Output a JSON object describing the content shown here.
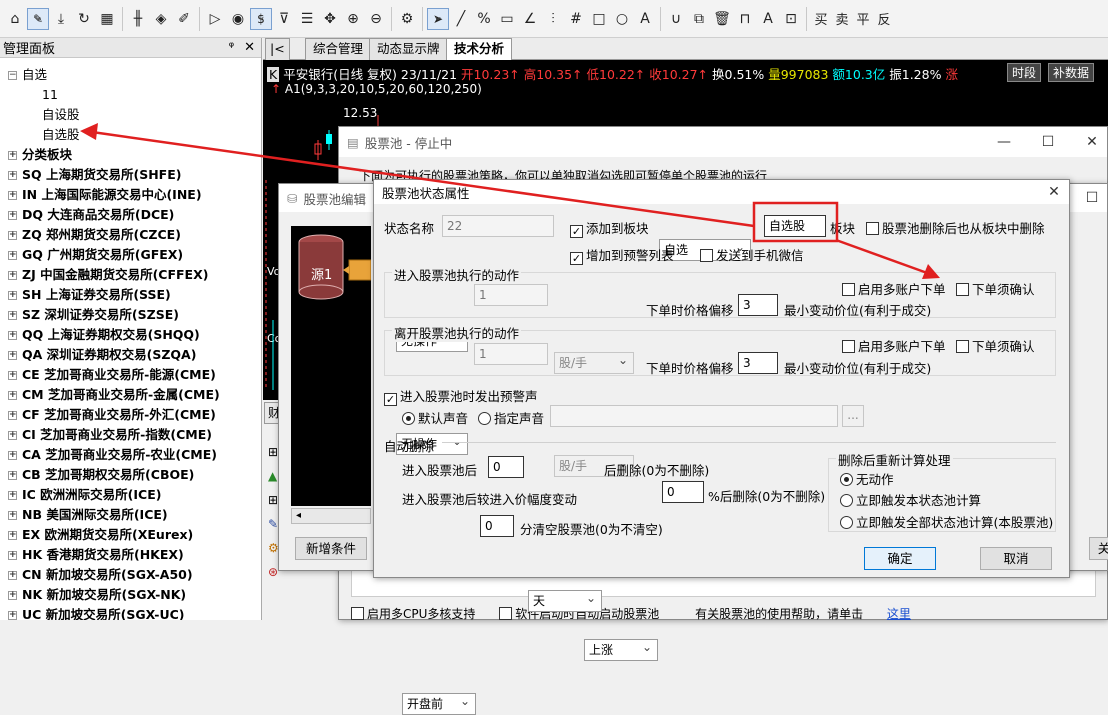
{
  "toolbar": {
    "icons": [
      "home-icon",
      "draw-icon",
      "download-icon",
      "refresh-icon",
      "grid-icon",
      "candle-icon",
      "alert-icon",
      "edit-icon",
      "play-icon",
      "currency-icon",
      "filter-icon",
      "move-icon",
      "zoom-in-icon",
      "zoom-out-icon",
      "settings-icon",
      "cursor-icon",
      "line-icon",
      "percent-icon",
      "ruler-icon",
      "angle-icon",
      "bars-icon",
      "hash-icon",
      "rect-icon",
      "circle-icon",
      "text-icon",
      "magnet-icon",
      "copy-icon",
      "delete-icon",
      "lock-icon",
      "color-icon",
      "save-icon",
      "sell-icon"
    ],
    "buy": "买",
    "sell": "卖",
    "flat": "平",
    "reverse": "反"
  },
  "left_panel": {
    "title": "管理面板",
    "pin": "ᵠ",
    "close": "✕",
    "tree": {
      "root": "自选",
      "children": [
        "11",
        "自设股",
        "自选股"
      ],
      "categories": [
        "分类板块",
        "SQ 上海期货交易所(SHFE)",
        "IN 上海国际能源交易中心(INE)",
        "DQ 大连商品交易所(DCE)",
        "ZQ 郑州期货交易所(CZCE)",
        "GQ 广州期货交易所(GFEX)",
        "ZJ 中国金融期货交易所(CFFEX)",
        "SH 上海证券交易所(SSE)",
        "SZ 深圳证券交易所(SZSE)",
        "QQ 上海证券期权交易(SHQQ)",
        "QA 深圳证券期权交易(SZQA)",
        "CE 芝加哥商业交易所-能源(CME)",
        "CM 芝加哥商业交易所-金属(CME)",
        "CF 芝加哥商业交易所-外汇(CME)",
        "CI 芝加哥商业交易所-指数(CME)",
        "CA 芝加哥商业交易所-农业(CME)",
        "CB 芝加哥期权交易所(CBOE)",
        "IC 欧洲洲际交易所(ICE)",
        "NB 美国洲际交易所(ICE)",
        "EX 欧洲期货交易所(XEurex)",
        "HK 香港期货交易所(HKEX)",
        "CN 新加坡交易所(SGX-A50)",
        "NK 新加坡交易所(SGX-NK)",
        "UC 新加坡交易所(SGX-UC)"
      ]
    }
  },
  "tabs": {
    "arrow": "|<",
    "items": [
      "综合管理",
      "动态显示牌",
      "技术分析"
    ]
  },
  "chart": {
    "k_label": "K",
    "name": "平安银行(日线 复权) 23/11/21",
    "open": "开10.23↑",
    "high": "高10.35↑",
    "low": "低10.22↑",
    "close": "收10.27↑",
    "turnover": "换0.51%",
    "volume": "量997083",
    "amount": "额10.3亿",
    "amplitude": "振1.28%",
    "extra": "涨",
    "btn_period": "时段",
    "btn_data": "补数据",
    "ma_line": "A1(9,3,3,20,10,5,20,60,120,250)",
    "price_label": "12.53",
    "left_labels": [
      "Vo",
      "Co"
    ]
  },
  "pool_window": {
    "title": "股票池 - 停止中",
    "description": "下面为可执行的股票池策略，你可以单独取消勾选即可暂停单个股票池的运行",
    "bottom_opts": [
      "启用多CPU多核支持",
      "软件启动时自动启动股票池"
    ],
    "help": "有关股票池的使用帮助，请单击",
    "help_link": "这里"
  },
  "editor_window": {
    "title": "股票池编辑",
    "source": "源1",
    "add_condition": "新增条件",
    "right_btn": "关"
  },
  "side_icons": {
    "tab": "财"
  },
  "dialog": {
    "title": "股票池状态属性",
    "state_name_label": "状态名称",
    "state_name_value": "22",
    "add_to_block": "添加到板块",
    "block_select": "自选",
    "block_input": "自选股",
    "block_label": "板块",
    "delete_from_block": "股票池删除后也从板块中删除",
    "add_alert_list": "增加到预警列表",
    "send_wechat": "发送到手机微信",
    "enter_group": "进入股票池执行的动作",
    "leave_group": "离开股票池执行的动作",
    "action_value": "无操作",
    "qty_value": "1",
    "unit_value": "股/手",
    "multi_account": "启用多账户下单",
    "confirm_order": "下单须确认",
    "price_offset_label": "下单时价格偏移",
    "price_offset_value": "3",
    "min_tick_label": "最小变动价位(有利于成交)",
    "alert_on_enter": "进入股票池时发出预警声",
    "default_sound": "默认声音",
    "custom_sound": "指定声音",
    "browse": "...",
    "auto_delete": "自动删除",
    "after_enter": "进入股票池后",
    "after_enter_value": "0",
    "day_unit": "天",
    "after_enter_note": "后删除(0为不删除)",
    "range_label": "进入股票池后较进入价幅度变动",
    "range_dir": "上涨",
    "range_value": "0",
    "range_note": "%后删除(0为不删除)",
    "clear_time": "开盘前",
    "clear_value": "0",
    "clear_note": "分清空股票池(0为不清空)",
    "recalc_title": "删除后重新计算处理",
    "recalc_opts": [
      "无动作",
      "立即触发本状态池计算",
      "立即触发全部状态池计算(本股票池)"
    ],
    "ok": "确定",
    "cancel": "取消",
    "close": "✕"
  },
  "annotation_color": "#e02020"
}
